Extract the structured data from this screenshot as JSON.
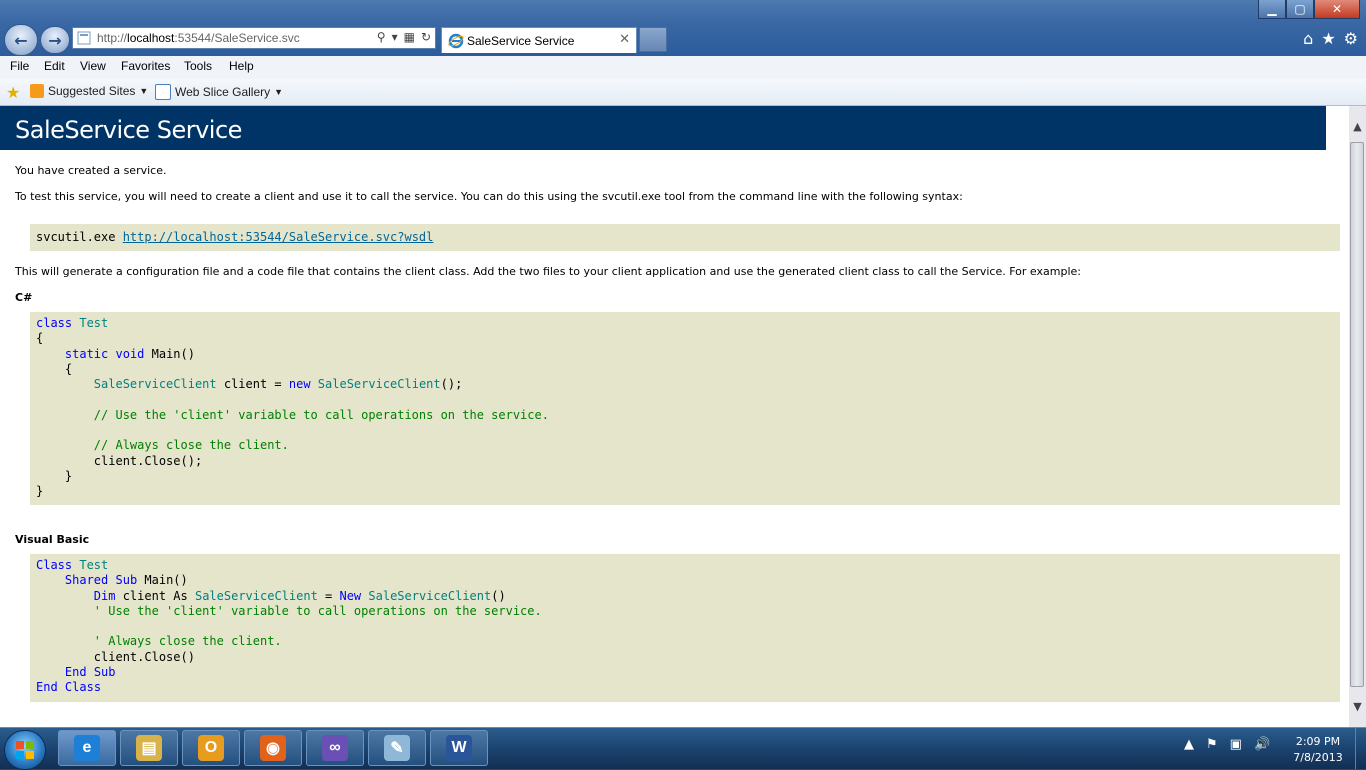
{
  "window": {
    "controls": {
      "minimize": "▁",
      "maximize": "▢",
      "close": "✕"
    }
  },
  "browser": {
    "address": {
      "prefix": "http://",
      "host": "localhost",
      "rest": ":53544/SaleService.svc"
    },
    "tab": {
      "title": "SaleService Service"
    }
  },
  "menu": {
    "items": [
      "File",
      "Edit",
      "View",
      "Favorites",
      "Tools",
      "Help"
    ]
  },
  "favorites": {
    "items": [
      {
        "label": "Suggested Sites",
        "icon": "suggested-sites-icon"
      },
      {
        "label": "Web Slice Gallery",
        "icon": "web-slice-icon"
      }
    ]
  },
  "page": {
    "title": "SaleService Service",
    "created": "You have created a service.",
    "instructions": "To test this service, you will need to create a client and use it to call the service. You can do this using the svcutil.exe tool from the command line with the following syntax:",
    "svcutil": {
      "cmd": "svcutil.exe ",
      "url": "http://localhost:53544/SaleService.svc?wsdl"
    },
    "generate": "This will generate a configuration file and a code file that contains the client class. Add the two files to your client application and use the generated client class to call the Service. For example:",
    "csharp_label": "C#",
    "vb_label": "Visual Basic",
    "csharp_lines": [
      [
        {
          "t": "class",
          "c": "kw"
        },
        {
          "t": " "
        },
        {
          "t": "Test",
          "c": "ty"
        }
      ],
      [
        {
          "t": "{"
        }
      ],
      [
        {
          "t": "    "
        },
        {
          "t": "static",
          "c": "kw"
        },
        {
          "t": " "
        },
        {
          "t": "void",
          "c": "kw"
        },
        {
          "t": " Main()"
        }
      ],
      [
        {
          "t": "    {"
        }
      ],
      [
        {
          "t": "        "
        },
        {
          "t": "SaleServiceClient",
          "c": "ty"
        },
        {
          "t": " client = "
        },
        {
          "t": "new",
          "c": "kw"
        },
        {
          "t": " "
        },
        {
          "t": "SaleServiceClient",
          "c": "ty"
        },
        {
          "t": "();"
        }
      ],
      [],
      [
        {
          "t": "        "
        },
        {
          "t": "// Use the 'client' variable to call operations on the service.",
          "c": "cm"
        }
      ],
      [],
      [
        {
          "t": "        "
        },
        {
          "t": "// Always close the client.",
          "c": "cm"
        }
      ],
      [
        {
          "t": "        client.Close();"
        }
      ],
      [
        {
          "t": "    }"
        }
      ],
      [
        {
          "t": "}"
        }
      ]
    ],
    "vb_lines": [
      [
        {
          "t": "Class",
          "c": "kw"
        },
        {
          "t": " "
        },
        {
          "t": "Test",
          "c": "ty"
        }
      ],
      [
        {
          "t": "    "
        },
        {
          "t": "Shared",
          "c": "kw"
        },
        {
          "t": " "
        },
        {
          "t": "Sub",
          "c": "kw"
        },
        {
          "t": " Main()"
        }
      ],
      [
        {
          "t": "        "
        },
        {
          "t": "Dim",
          "c": "kw"
        },
        {
          "t": " client As "
        },
        {
          "t": "SaleServiceClient",
          "c": "ty"
        },
        {
          "t": " = "
        },
        {
          "t": "New",
          "c": "kw"
        },
        {
          "t": " "
        },
        {
          "t": "SaleServiceClient",
          "c": "ty"
        },
        {
          "t": "()"
        }
      ],
      [
        {
          "t": "        "
        },
        {
          "t": "' Use the 'client' variable to call operations on the service.",
          "c": "cm"
        }
      ],
      [],
      [
        {
          "t": "        "
        },
        {
          "t": "' Always close the client.",
          "c": "cm"
        }
      ],
      [
        {
          "t": "        client.Close()"
        }
      ],
      [
        {
          "t": "    "
        },
        {
          "t": "End",
          "c": "kw"
        },
        {
          "t": " "
        },
        {
          "t": "Sub",
          "c": "kw"
        }
      ],
      [
        {
          "t": "End",
          "c": "kw"
        },
        {
          "t": " "
        },
        {
          "t": "Class",
          "c": "kw"
        }
      ]
    ]
  },
  "taskbar": {
    "apps": [
      {
        "name": "taskbar-ie",
        "icon": "internet-explorer-icon",
        "glyph": "e",
        "color": "#1e7fd6",
        "active": true
      },
      {
        "name": "taskbar-explorer",
        "icon": "folder-icon",
        "glyph": "▤",
        "color": "#d9b24a",
        "active": false
      },
      {
        "name": "taskbar-outlook",
        "icon": "outlook-icon",
        "glyph": "O",
        "color": "#e79b1f",
        "active": false
      },
      {
        "name": "taskbar-firefox",
        "icon": "firefox-icon",
        "glyph": "◉",
        "color": "#e0621b",
        "active": false
      },
      {
        "name": "taskbar-visualstudio",
        "icon": "visual-studio-icon",
        "glyph": "∞",
        "color": "#6a4fb5",
        "active": false
      },
      {
        "name": "taskbar-paint",
        "icon": "paint-icon",
        "glyph": "✎",
        "color": "#8fb7d8",
        "active": false
      },
      {
        "name": "taskbar-word",
        "icon": "word-icon",
        "glyph": "W",
        "color": "#2a5699",
        "active": false
      }
    ],
    "clock": {
      "time": "2:09 PM",
      "date": "7/8/2013"
    }
  }
}
